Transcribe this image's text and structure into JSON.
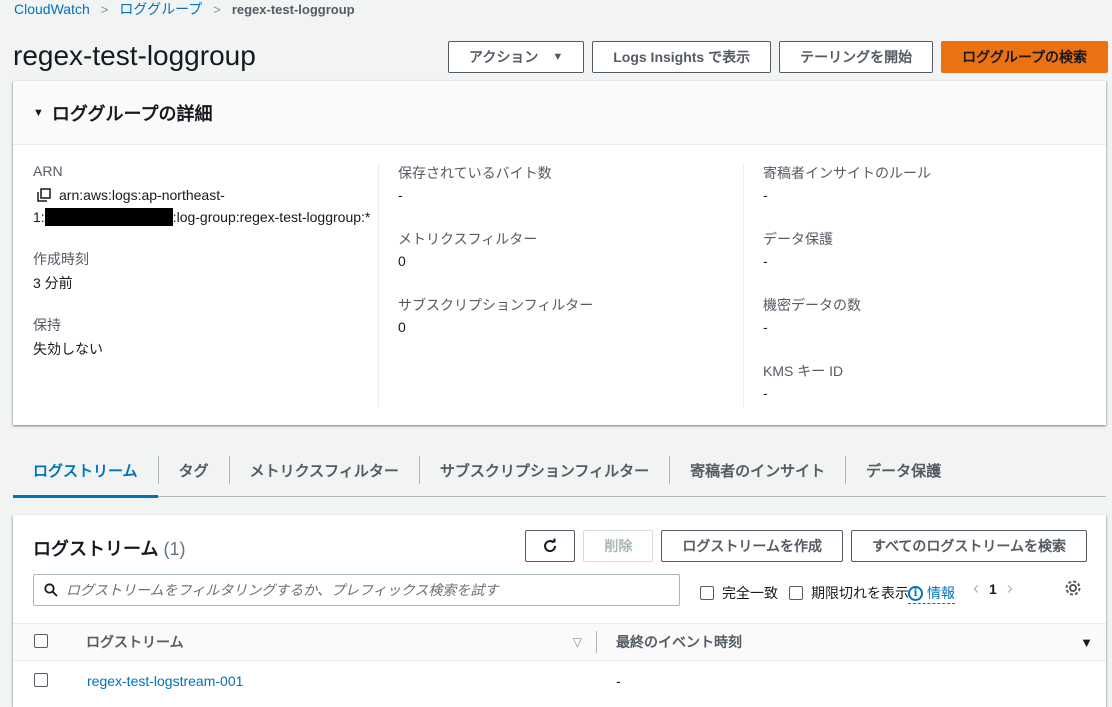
{
  "breadcrumb": {
    "items": [
      "CloudWatch",
      "ロググループ"
    ],
    "current": "regex-test-loggroup"
  },
  "page": {
    "title": "regex-test-loggroup"
  },
  "header_actions": {
    "actions_label": "アクション",
    "insights_label": "Logs Insights で表示",
    "tailing_label": "テーリングを開始",
    "search_label": "ロググループの検索"
  },
  "details": {
    "title": "ロググループの詳細",
    "arn_label": "ARN",
    "arn_line1": "arn:aws:logs:ap-northeast-",
    "arn_prefix": "1:",
    "arn_suffix": ":log-group:regex-test-loggroup:*",
    "created_label": "作成時刻",
    "created_value": "3 分前",
    "retention_label": "保持",
    "retention_value": "失効しない",
    "stored_bytes_label": "保存されているバイト数",
    "stored_bytes_value": "-",
    "metric_filters_label": "メトリクスフィルター",
    "metric_filters_value": "0",
    "subscription_filters_label": "サブスクリプションフィルター",
    "subscription_filters_value": "0",
    "contributor_label": "寄稿者インサイトのルール",
    "contributor_value": "-",
    "data_protection_label": "データ保護",
    "data_protection_value": "-",
    "sensitive_label": "機密データの数",
    "sensitive_value": "-",
    "kms_label": "KMS キー ID",
    "kms_value": "-"
  },
  "tabs": [
    {
      "label": "ログストリーム",
      "active": true
    },
    {
      "label": "タグ"
    },
    {
      "label": "メトリクスフィルター"
    },
    {
      "label": "サブスクリプションフィルター"
    },
    {
      "label": "寄稿者のインサイト"
    },
    {
      "label": "データ保護"
    }
  ],
  "streams": {
    "title": "ログストリーム",
    "count": "(1)",
    "delete_label": "削除",
    "create_label": "ログストリームを作成",
    "search_all_label": "すべてのログストリームを検索",
    "search_placeholder": "ログストリームをフィルタリングするか、プレフィックス検索を試す",
    "exact_match_label": "完全一致",
    "show_expired_label": "期限切れを表示",
    "info_label": "情報",
    "page_number": "1",
    "columns": {
      "name": "ログストリーム",
      "last_event": "最終のイベント時刻"
    },
    "rows": [
      {
        "name": "regex-test-logstream-001",
        "last_event": "-"
      }
    ]
  }
}
